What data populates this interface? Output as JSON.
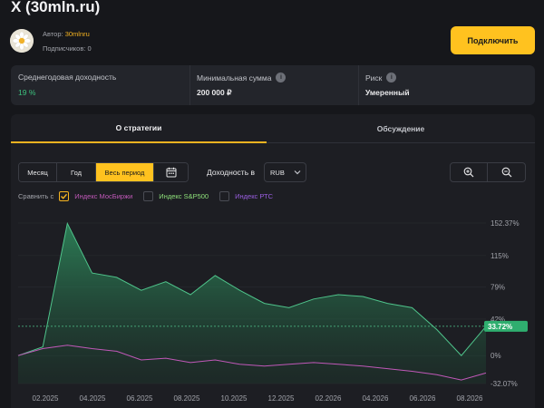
{
  "header": {
    "title": "X (30mln.ru)",
    "author_label": "Автор:",
    "author_name": "30mlnru",
    "subscribers_label": "Подписчиков:",
    "subscribers_count": "0",
    "connect_label": "Подключить"
  },
  "stats": [
    {
      "label": "Среднегодовая доходность",
      "value": "19 %"
    },
    {
      "label": "Минимальная сумма",
      "value": "200 000 ₽"
    },
    {
      "label": "Риск",
      "value": "Умеренный"
    }
  ],
  "tabs": [
    "О стратегии",
    "Обсуждение"
  ],
  "periods": [
    "Месяц",
    "Год",
    "Весь период"
  ],
  "active_period": "Весь период",
  "yield_label": "Доходность в",
  "currency": "RUB",
  "compare_label": "Сравнить с",
  "indices": [
    {
      "name": "Индекс МосБиржи",
      "checked": true,
      "color": "#c058b8"
    },
    {
      "name": "Индекс S&P500",
      "checked": false,
      "color": "#8ee07a"
    },
    {
      "name": "Индекс РТС",
      "checked": false,
      "color": "#9a5ee0"
    }
  ],
  "colors": {
    "accent": "#ffc21f",
    "positive": "#3cc27e",
    "strategy_line": "#4fc48b",
    "index_line": "#c058b8"
  },
  "chart_data": {
    "type": "area",
    "x": [
      "2025-01",
      "2025-02",
      "2025-03",
      "2025-04",
      "2025-05",
      "2025-06",
      "2025-07",
      "2025-08",
      "2025-09",
      "2025-10",
      "2025-11",
      "2025-12",
      "2026-01",
      "2026-02",
      "2026-03",
      "2026-04",
      "2026-05",
      "2026-06",
      "2026-07",
      "2026-08"
    ],
    "xticks": [
      "02.2025",
      "04.2025",
      "06.2025",
      "08.2025",
      "10.2025",
      "12.2025",
      "02.2026",
      "04.2026",
      "06.2026",
      "08.2026"
    ],
    "yticks": [
      "152.37%",
      "115%",
      "79%",
      "42%",
      "0%",
      "-32.07%"
    ],
    "ylim": [
      -32.07,
      152.37
    ],
    "series": [
      {
        "values": [
          0,
          10,
          152,
          95,
          90,
          75,
          85,
          70,
          92,
          75,
          60,
          55,
          65,
          70,
          68,
          60,
          55,
          30,
          0,
          33.72
        ]
      },
      {
        "name": "Индекс МосБиржи",
        "values": [
          0,
          8,
          12,
          8,
          5,
          -5,
          -3,
          -8,
          -5,
          -10,
          -12,
          -10,
          -8,
          -10,
          -12,
          -15,
          -18,
          -22,
          -28,
          -20
        ]
      }
    ],
    "current_label": "33.72%"
  }
}
